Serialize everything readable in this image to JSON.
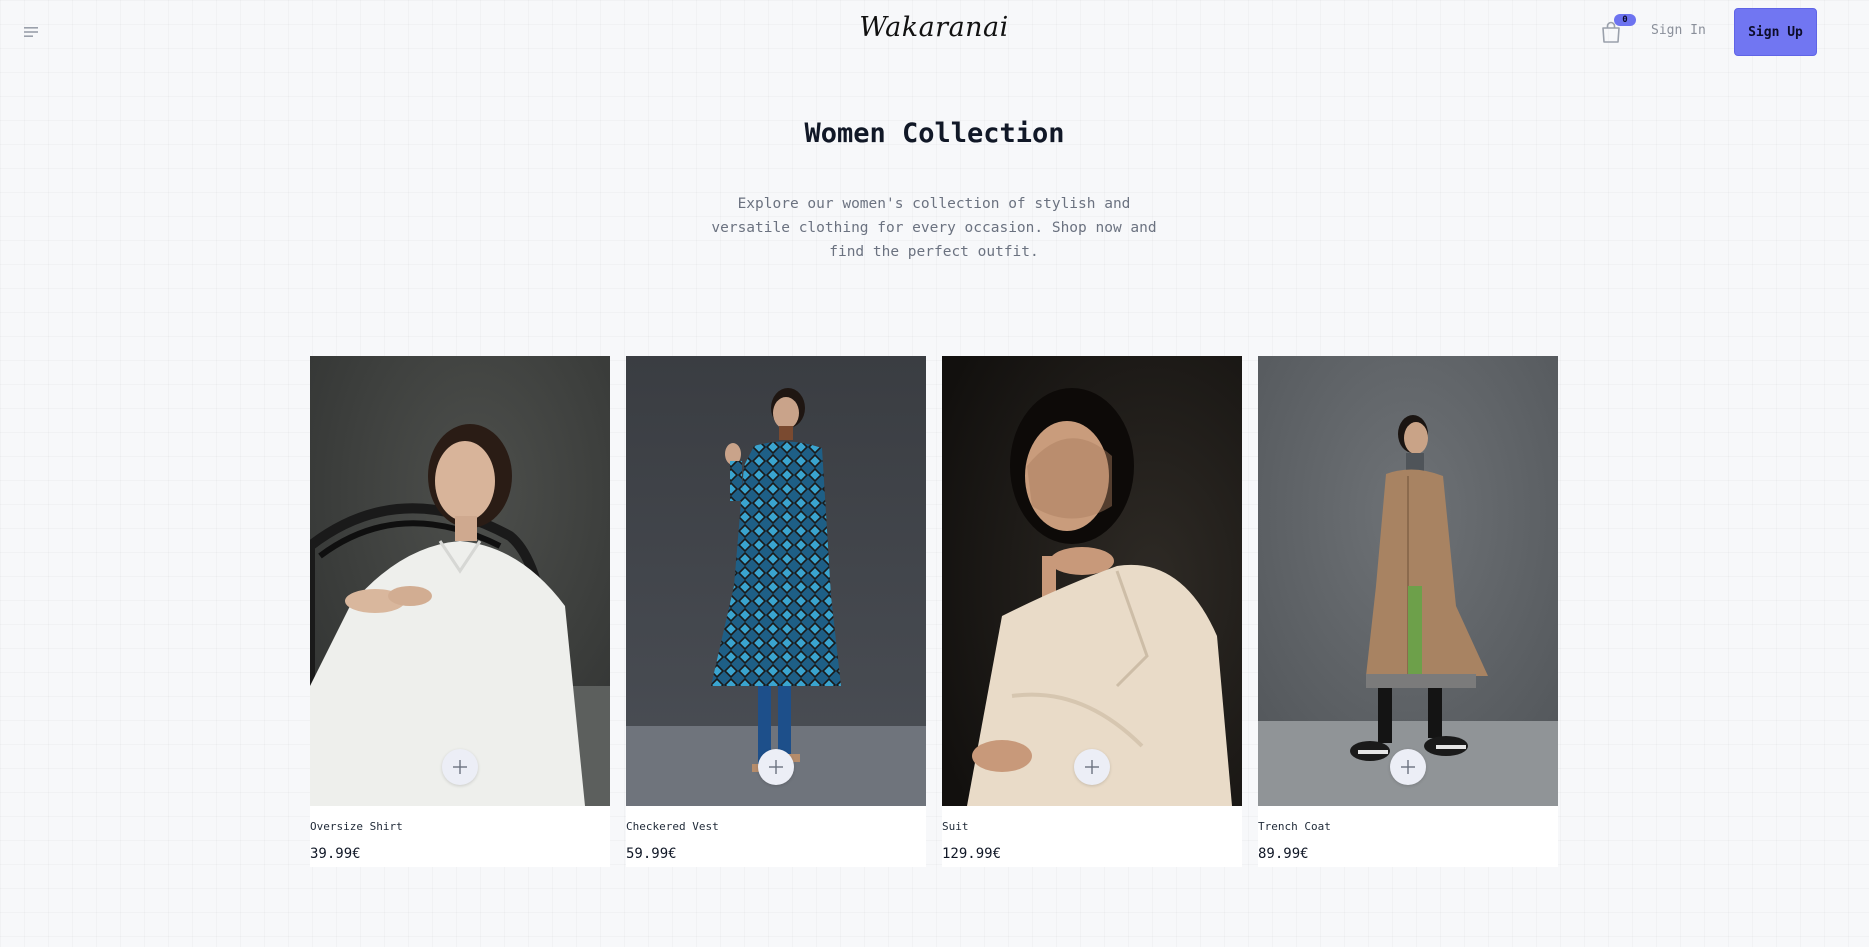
{
  "header": {
    "logo": "Wakaranai",
    "cart_count": "0",
    "signin_label": "Sign In",
    "signup_label": "Sign Up",
    "icons": {
      "menu": "menu-icon",
      "cart": "shopping-bag-icon"
    }
  },
  "hero": {
    "title": "Women Collection",
    "description": "Explore our women's collection of stylish and versatile clothing for every occasion. Shop now and find the perfect outfit."
  },
  "products": [
    {
      "name": "Oversize Shirt",
      "price": "39.99€"
    },
    {
      "name": "Checkered Vest",
      "price": "59.99€"
    },
    {
      "name": "Suit",
      "price": "129.99€"
    },
    {
      "name": "Trench Coat",
      "price": "89.99€"
    }
  ],
  "colors": {
    "accent": "#7176f2",
    "background": "#f7f8fa",
    "text": "#111827",
    "muted": "#6b7280"
  }
}
